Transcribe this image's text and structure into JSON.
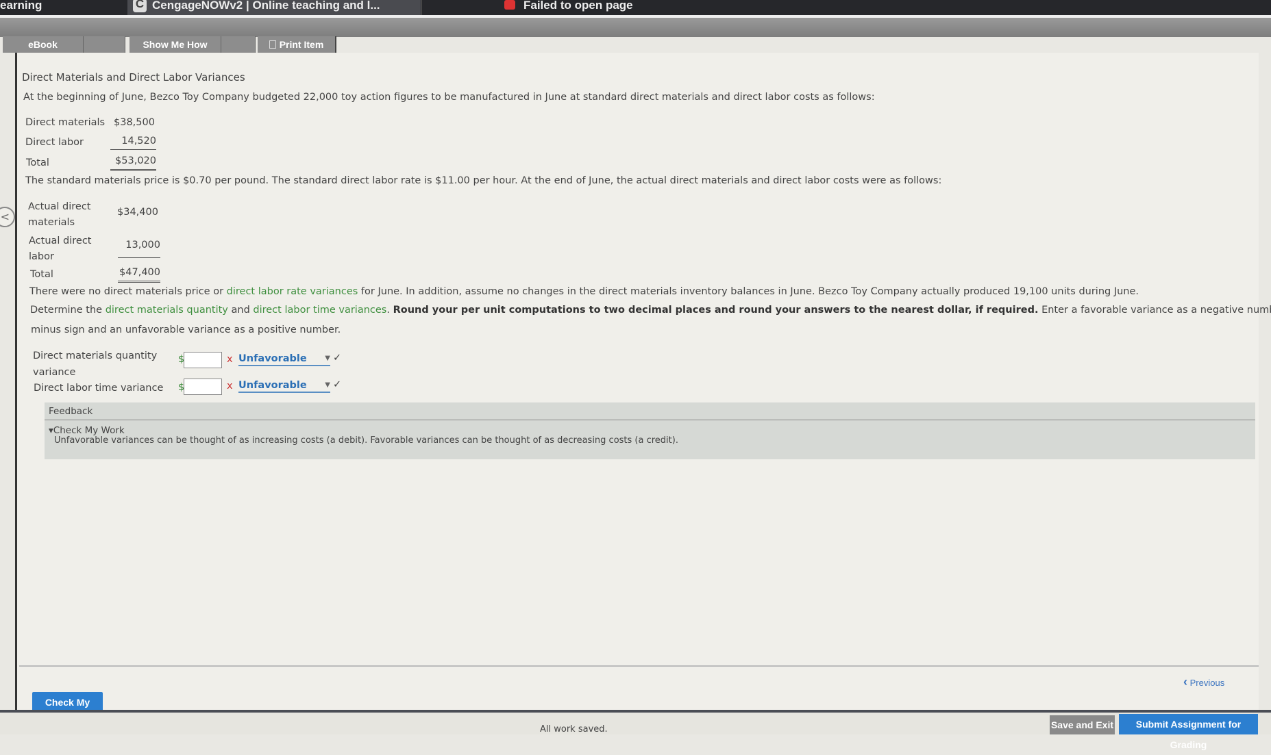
{
  "browser_tabs": [
    "earning",
    "CengageNOWv2 | Online teaching and l...",
    "Failed to open page"
  ],
  "tabs": {
    "ebook": "eBook",
    "show_me_how": "Show Me How",
    "print_item": "Print Item"
  },
  "title": "Direct Materials and Direct Labor Variances",
  "intro": "At the beginning of June, Bezco Toy Company budgeted 22,000 toy action figures to be manufactured in June at standard direct materials and direct labor costs as follows:",
  "budget": [
    {
      "label": "Direct materials",
      "value": "$38,500"
    },
    {
      "label": "Direct labor",
      "value": "14,520"
    },
    {
      "label": "Total",
      "value": "$53,020"
    }
  ],
  "standard_text": "The standard materials price is $0.70 per pound. The standard direct labor rate is $11.00 per hour. At the end of June, the actual direct materials and direct labor costs were as follows:",
  "actual": [
    {
      "label1": "Actual direct",
      "label2": "materials",
      "value": "$34,400"
    },
    {
      "label1": "Actual direct",
      "label2": "labor",
      "value": "13,000"
    },
    {
      "label1": "Total",
      "label2": "",
      "value": "$47,400"
    }
  ],
  "note": {
    "p1": "There were no direct materials price or ",
    "link1": "direct labor rate variances",
    "p2": " for June. In addition, assume no changes in the direct materials inventory balances in June. Bezco Toy Company actually produced 19,100 units during June."
  },
  "instructions": {
    "p1": "Determine the ",
    "link1": "direct materials quantity",
    "p2": " and ",
    "link2": "direct labor time variances",
    "p3": ". ",
    "bold": "Round your per unit computations to two decimal places and round your answers to the nearest dollar, if required.",
    "p4": " Enter a favorable variance as a negative number using a",
    "line2": "minus sign and an unfavorable variance as a positive number."
  },
  "answers": [
    {
      "label1": "Direct materials quantity",
      "label2": "variance",
      "currency": "$",
      "value": "",
      "mark": "x",
      "selected": "Unfavorable",
      "check": "✓"
    },
    {
      "label1": "Direct labor time variance",
      "label2": "",
      "currency": "$",
      "value": "",
      "mark": "x",
      "selected": "Unfavorable",
      "check": "✓"
    }
  ],
  "feedback": {
    "heading": "Feedback",
    "toggle": "Check My Work",
    "text": "Unfavorable variances can be thought of as increasing costs (a debit). Favorable variances can be thought of as decreasing costs (a credit)."
  },
  "check_my_work": "Check My Work",
  "previous": "Previous",
  "status": "All work saved.",
  "save_exit": "Save and Exit",
  "submit": "Submit Assignment for Grading"
}
